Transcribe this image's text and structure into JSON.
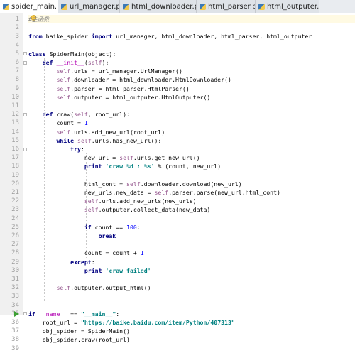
{
  "tabs": [
    {
      "label": "spider_main.py",
      "close": "×",
      "active": true
    },
    {
      "label": "url_manager.py",
      "close": "×",
      "active": false
    },
    {
      "label": "html_downloader.py",
      "close": "×",
      "active": false
    },
    {
      "label": "html_parser.py",
      "close": "×",
      "active": false
    },
    {
      "label": "html_outputer.py",
      "close": "×",
      "active": false
    }
  ],
  "line_numbers": [
    "1",
    "2",
    "3",
    "4",
    "5",
    "6",
    "7",
    "8",
    "9",
    "10",
    "11",
    "12",
    "13",
    "14",
    "15",
    "16",
    "17",
    "18",
    "19",
    "20",
    "21",
    "22",
    "23",
    "24",
    "25",
    "26",
    "27",
    "28",
    "29",
    "30",
    "31",
    "32",
    "33",
    "34",
    "35",
    "36",
    "37",
    "38",
    "39"
  ],
  "code_lines": [
    "#主函数",
    "",
    "from baike_spider import url_manager, html_downloader, html_parser, html_outputer",
    "",
    "class SpiderMain(object):",
    "    def __init__(self):",
    "        self.urls = url_manager.UrlManager()",
    "        self.downloader = html_downloader.HtmlDownloader()",
    "        self.parser = html_parser.HtmlParser()",
    "        self.outputer = html_outputer.HtmlOutputer()",
    "",
    "    def craw(self, root_url):",
    "        count = 1",
    "        self.urls.add_new_url(root_url)",
    "        while self.urls.has_new_url():",
    "            try:",
    "                new_url = self.urls.get_new_url()",
    "                print 'craw %d : %s' % (count, new_url)",
    "",
    "                html_cont = self.downloader.download(new_url)",
    "                new_urls,new_data = self.parser.parse(new_url,html_cont)",
    "                self.urls.add_new_urls(new_urls)",
    "                self.outputer.collect_data(new_data)",
    "",
    "                if count == 100:",
    "                    break",
    "",
    "                count = count + 1",
    "            except:",
    "                print 'craw failed'",
    "",
    "        self.outputer.output_html()",
    "",
    "",
    "if __name__ == \"__main__\":",
    "    root_url = \"https://baike.baidu.com/item/Python/407313\"",
    "    obj_spider = SpiderMain()",
    "    obj_spider.craw(root_url)",
    ""
  ],
  "icons": {
    "file_tab": "python-file-icon",
    "intention": "lightbulb-icon",
    "run": "run-arrow-icon"
  },
  "colors": {
    "keyword": "#000080",
    "self": "#94558d",
    "string": "#008080",
    "number": "#0000ff",
    "comment": "#808080",
    "current_line": "#fffae3"
  }
}
